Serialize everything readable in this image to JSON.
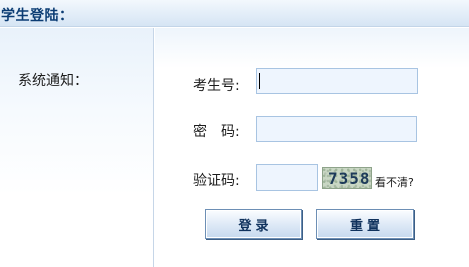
{
  "header": {
    "title": "学生登陆："
  },
  "sidebar": {
    "notice_label": "系统通知："
  },
  "form": {
    "student_id": {
      "label": "考生号:",
      "value": ""
    },
    "password": {
      "label": "密　码:",
      "value": ""
    },
    "captcha": {
      "label": "验证码:",
      "value": "",
      "image_text": "7358",
      "refresh_label": "看不清?"
    }
  },
  "buttons": {
    "login_label": "登录",
    "reset_label": "重置"
  },
  "colors": {
    "header_text": "#0b3c73",
    "input_bg": "#eef5fe",
    "input_border": "#a8c4e2",
    "button_border": "#6d8fb5"
  }
}
